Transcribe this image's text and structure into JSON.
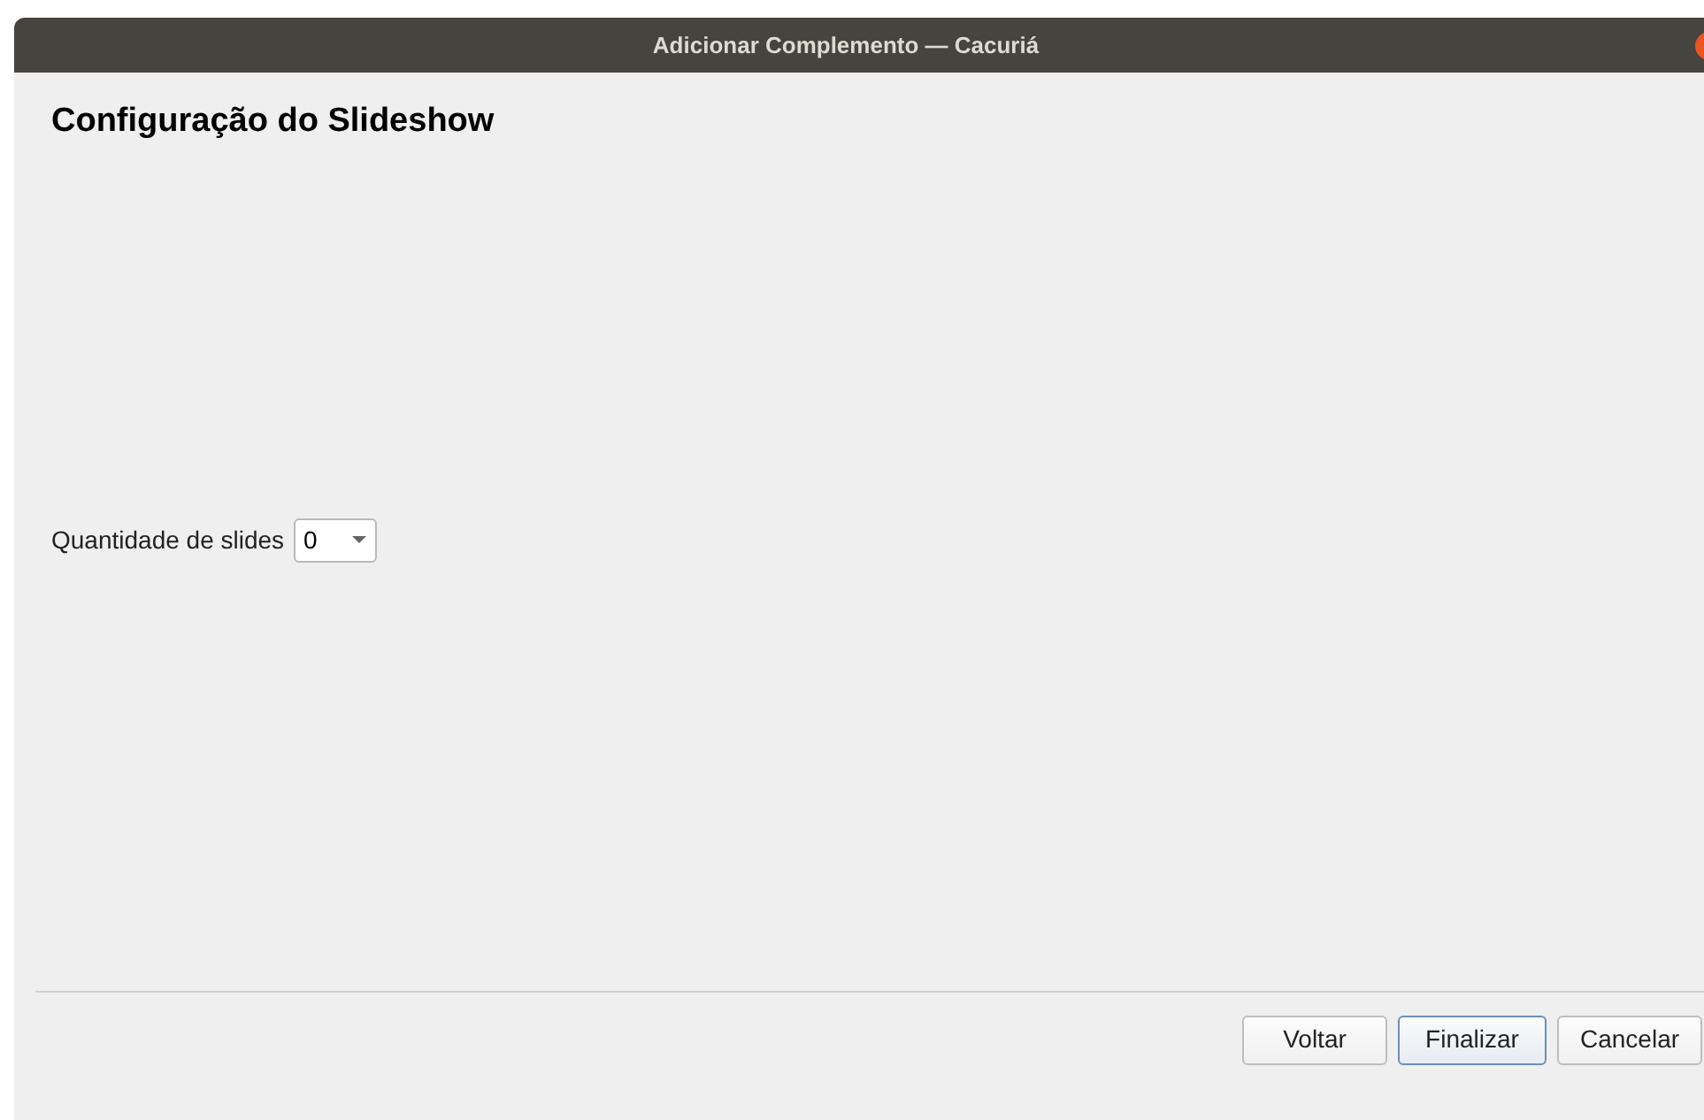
{
  "window": {
    "title": "Adicionar Complemento — Cacuriá"
  },
  "heading": "Configuração do Slideshow",
  "slide_count": {
    "label": "Quantidade de slides",
    "value": "0"
  },
  "buttons": [
    {
      "label": "Voltar",
      "default": false
    },
    {
      "label": "Finalizar",
      "default": true
    },
    {
      "label": "Cancelar",
      "default": false
    }
  ]
}
